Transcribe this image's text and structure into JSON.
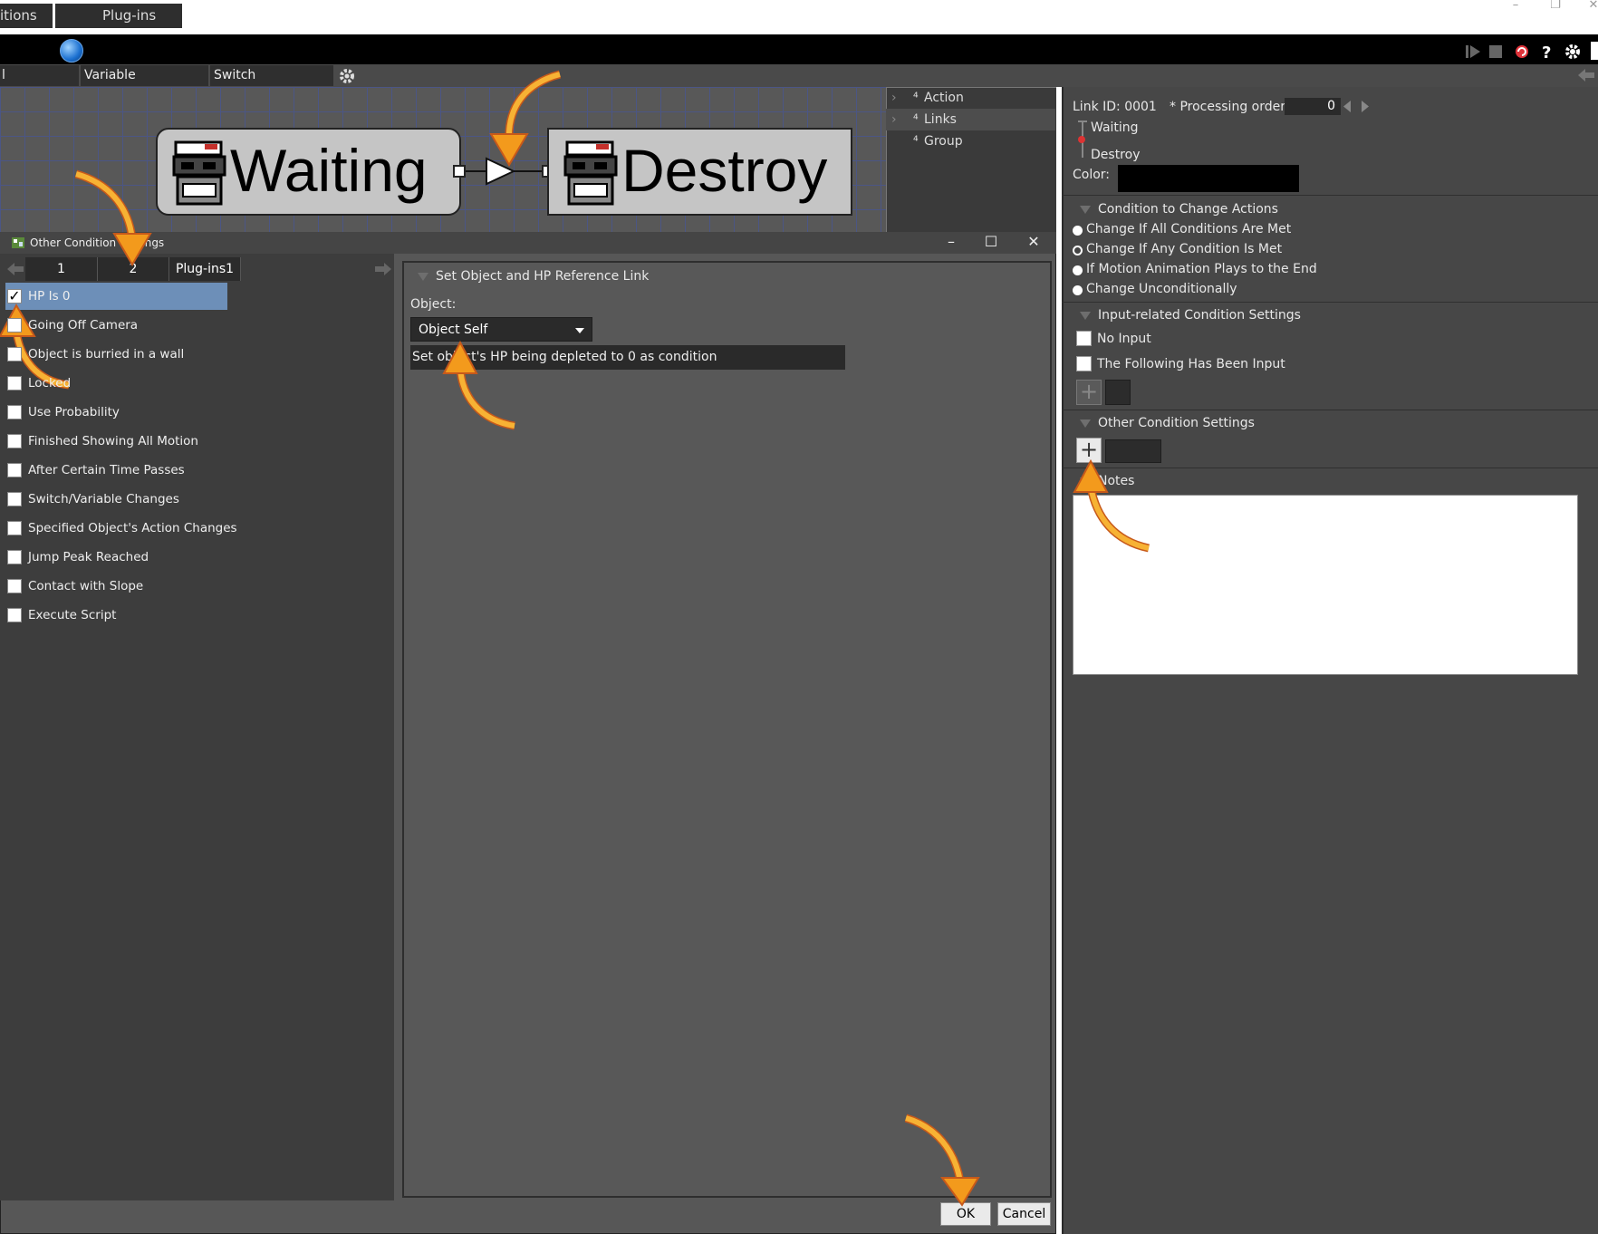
{
  "os": {
    "minimize": "–",
    "restore": "❐",
    "close": "✕"
  },
  "menubar": {
    "tabs": [
      {
        "label": "itions"
      },
      {
        "label": "Plug-ins"
      }
    ]
  },
  "subbar": {
    "tabs": [
      {
        "label": "l relationship"
      },
      {
        "label": "Variable management"
      },
      {
        "label": "Switch management"
      }
    ]
  },
  "canvas": {
    "source_node": "Waiting",
    "target_node": "Destroy"
  },
  "tree": {
    "items": [
      {
        "label": "Action"
      },
      {
        "label": "Links"
      },
      {
        "label": "Group"
      }
    ]
  },
  "link_panel": {
    "link_id": "Link ID: 0001",
    "processing_order_label": "* Processing order:",
    "processing_order_value": "0",
    "from": "Waiting",
    "to": "Destroy",
    "color_label": "Color:",
    "color_value": "#000000",
    "change_section": {
      "title": "Condition to Change Actions",
      "options": [
        {
          "label": "Change If All Conditions Are Met",
          "selected": false
        },
        {
          "label": "Change If Any Condition Is Met",
          "selected": true
        },
        {
          "label": "If Motion Animation Plays to the End",
          "selected": false
        },
        {
          "label": "Change Unconditionally",
          "selected": false
        }
      ]
    },
    "input_section": {
      "title": "Input-related Condition Settings",
      "no_input": "No Input",
      "following_input": "The Following Has Been Input"
    },
    "other_section": {
      "title": "Other Condition Settings"
    },
    "notes_section": {
      "title": "Notes"
    }
  },
  "dialog": {
    "title": "Other Condition Settings",
    "tabs": [
      {
        "label": "1"
      },
      {
        "label": "2"
      },
      {
        "label": "Plug-ins1"
      }
    ],
    "conditions": [
      {
        "label": "HP Is 0",
        "checked": true
      },
      {
        "label": "Going Off Camera",
        "checked": false
      },
      {
        "label": "Object is burried in a wall",
        "checked": false
      },
      {
        "label": "Locked",
        "checked": false
      },
      {
        "label": "Use Probability",
        "checked": false
      },
      {
        "label": "Finished Showing All Motion",
        "checked": false
      },
      {
        "label": "After Certain Time Passes",
        "checked": false
      },
      {
        "label": "Switch/Variable Changes",
        "checked": false
      },
      {
        "label": "Specified Object's Action Changes",
        "checked": false
      },
      {
        "label": "Jump Peak Reached",
        "checked": false
      },
      {
        "label": "Contact with Slope",
        "checked": false
      },
      {
        "label": "Execute Script",
        "checked": false
      }
    ],
    "detail": {
      "section_title": "Set Object and HP Reference Link",
      "object_label": "Object:",
      "object_value": "Object Self",
      "description": "Set object's HP being depleted to 0 as condition"
    },
    "ok": "OK",
    "cancel": "Cancel"
  },
  "colors": {
    "accent_arrow": "#f5a623",
    "selected_row": "#6d8fb8"
  }
}
